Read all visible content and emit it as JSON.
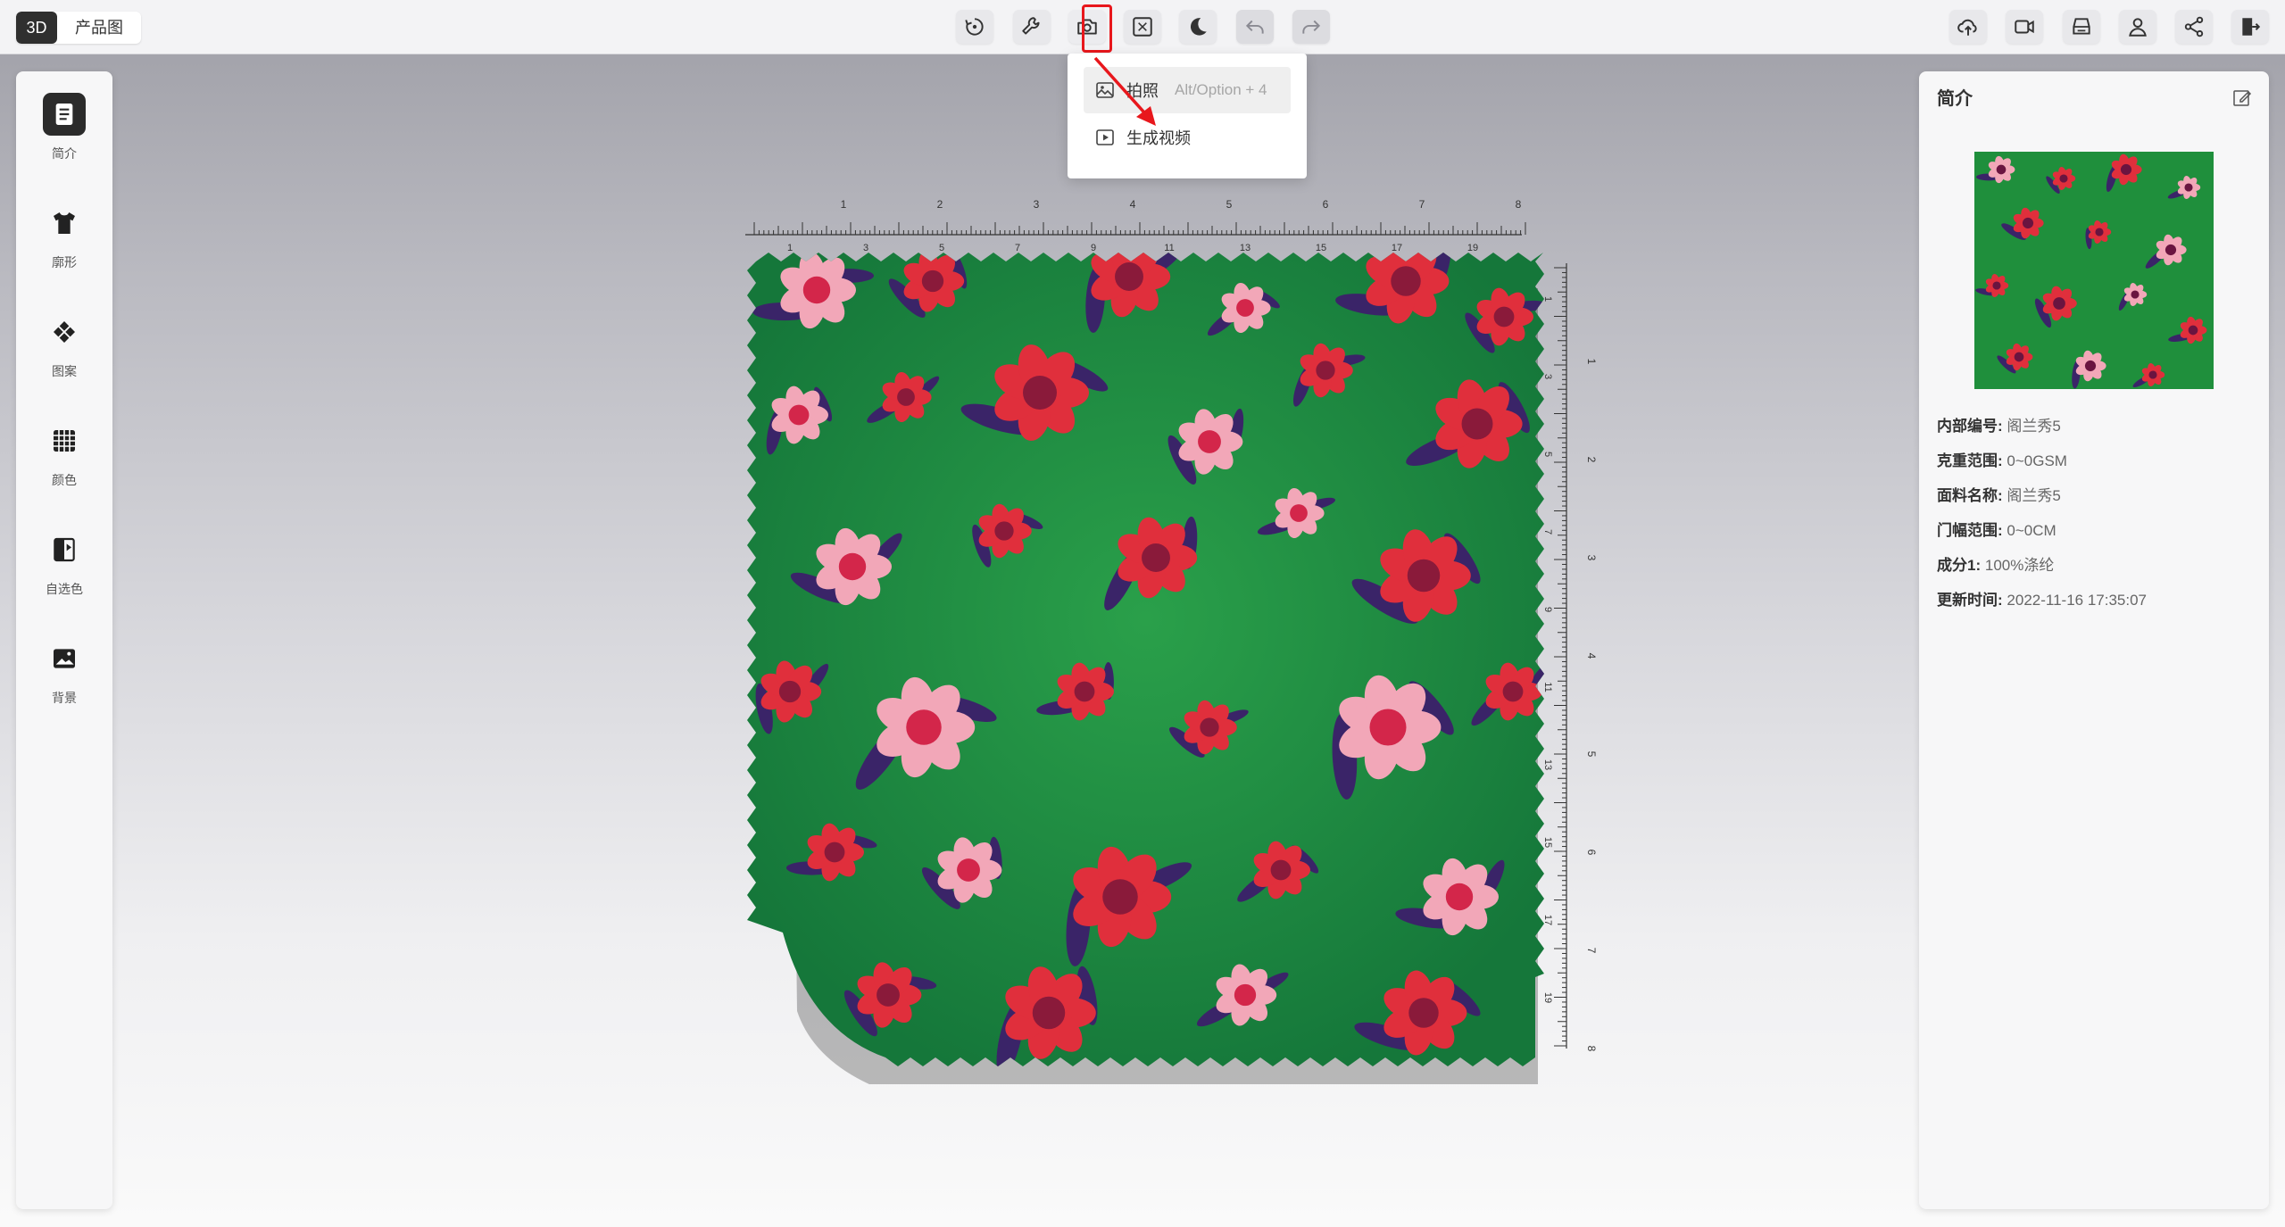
{
  "topbar": {
    "mode_3d": "3D",
    "mode_product": "产品图",
    "tools": [
      "rotate-reset-icon",
      "wrench-icon",
      "camera-icon",
      "fullscreen-icon",
      "night-mode-icon",
      "undo-icon",
      "redo-icon"
    ],
    "right_tools": [
      "cloud-upload-icon",
      "video-icon",
      "scanner-icon",
      "user-icon",
      "share-icon",
      "exit-icon"
    ]
  },
  "camera_menu": {
    "photo_label": "拍照",
    "photo_shortcut": "Alt/Option + 4",
    "video_label": "生成视频"
  },
  "sidebar": {
    "items": [
      {
        "label": "简介",
        "icon": "document-icon"
      },
      {
        "label": "廓形",
        "icon": "tshirt-icon"
      },
      {
        "label": "图案",
        "icon": "pattern-icon"
      },
      {
        "label": "颜色",
        "icon": "grid-color-icon"
      },
      {
        "label": "自选色",
        "icon": "custom-color-icon"
      },
      {
        "label": "背景",
        "icon": "image-background-icon"
      }
    ]
  },
  "panel": {
    "title": "简介",
    "rows": [
      {
        "key": "内部编号:",
        "value": "阁兰秀5"
      },
      {
        "key": "克重范围:",
        "value": "0~0GSM"
      },
      {
        "key": "面料名称:",
        "value": "阁兰秀5"
      },
      {
        "key": "门幅范围:",
        "value": "0~0CM"
      },
      {
        "key": "成分1:",
        "value": "100%涤纶"
      },
      {
        "key": "更新时间:",
        "value": "2022-11-16 17:35:07"
      }
    ]
  },
  "ruler": {
    "top_major": [
      "1",
      "2",
      "3",
      "4",
      "5",
      "6",
      "7",
      "8"
    ],
    "top_minor": [
      "1",
      "3",
      "5",
      "7",
      "9",
      "11",
      "13",
      "15",
      "17",
      "19"
    ],
    "side_major": [
      "1",
      "2",
      "3",
      "4",
      "5",
      "6",
      "7",
      "8"
    ],
    "side_minor": [
      "1",
      "3",
      "5",
      "7",
      "9",
      "11",
      "13",
      "15",
      "17",
      "19"
    ]
  },
  "colors": {
    "fabric_green": "#1f8f3c",
    "flower_red": "#e02f3c",
    "flower_pink": "#f2a7b8",
    "leaf_purple": "#3a2468",
    "highlight": "#e8171c"
  }
}
